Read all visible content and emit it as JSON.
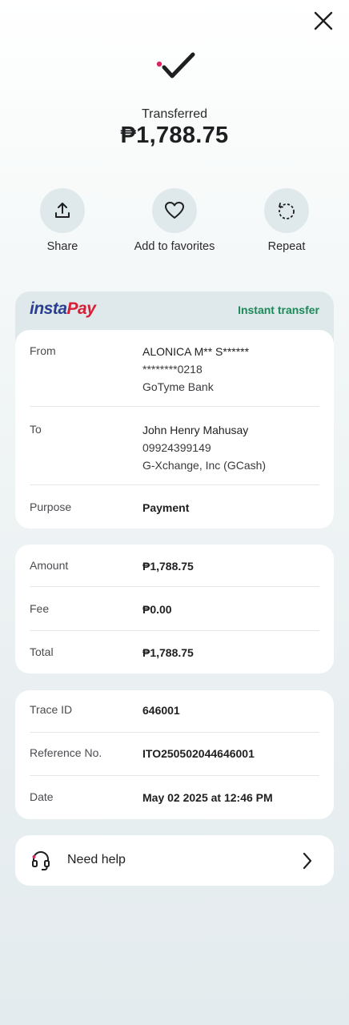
{
  "header": {
    "close_icon": "close-icon",
    "success_icon": "checkmark-icon",
    "status_label": "Transferred",
    "amount": "₱1,788.75"
  },
  "actions": [
    {
      "label": "Share",
      "icon": "share-upload-icon"
    },
    {
      "label": "Add to favorites",
      "icon": "heart-icon"
    },
    {
      "label": "Repeat",
      "icon": "repeat-icon"
    }
  ],
  "transfer": {
    "brand_part1": "insta",
    "brand_part2": "Pay",
    "type_label": "Instant transfer",
    "from_label": "From",
    "from_name": "ALONICA M** S******",
    "from_account": "********0218",
    "from_bank": "GoTyme Bank",
    "to_label": "To",
    "to_name": "John Henry Mahusay",
    "to_account": "09924399149",
    "to_bank": "G-Xchange, Inc (GCash)",
    "purpose_label": "Purpose",
    "purpose_value": "Payment"
  },
  "amounts": {
    "amount_label": "Amount",
    "amount_value": "₱1,788.75",
    "fee_label": "Fee",
    "fee_value": "₱0.00",
    "total_label": "Total",
    "total_value": "₱1,788.75"
  },
  "reference": {
    "trace_label": "Trace ID",
    "trace_value": "646001",
    "ref_label": "Reference No.",
    "ref_value": "ITO250502044646001",
    "date_label": "Date",
    "date_value": "May 02 2025 at 12:46 PM"
  },
  "help": {
    "label": "Need help",
    "icon": "headset-icon",
    "chevron": "chevron-right-icon"
  },
  "colors": {
    "brand_blue": "#2a3f8f",
    "brand_red": "#d61f36",
    "instant_green": "#1a8a58",
    "accent_dot": "#e0245e"
  }
}
